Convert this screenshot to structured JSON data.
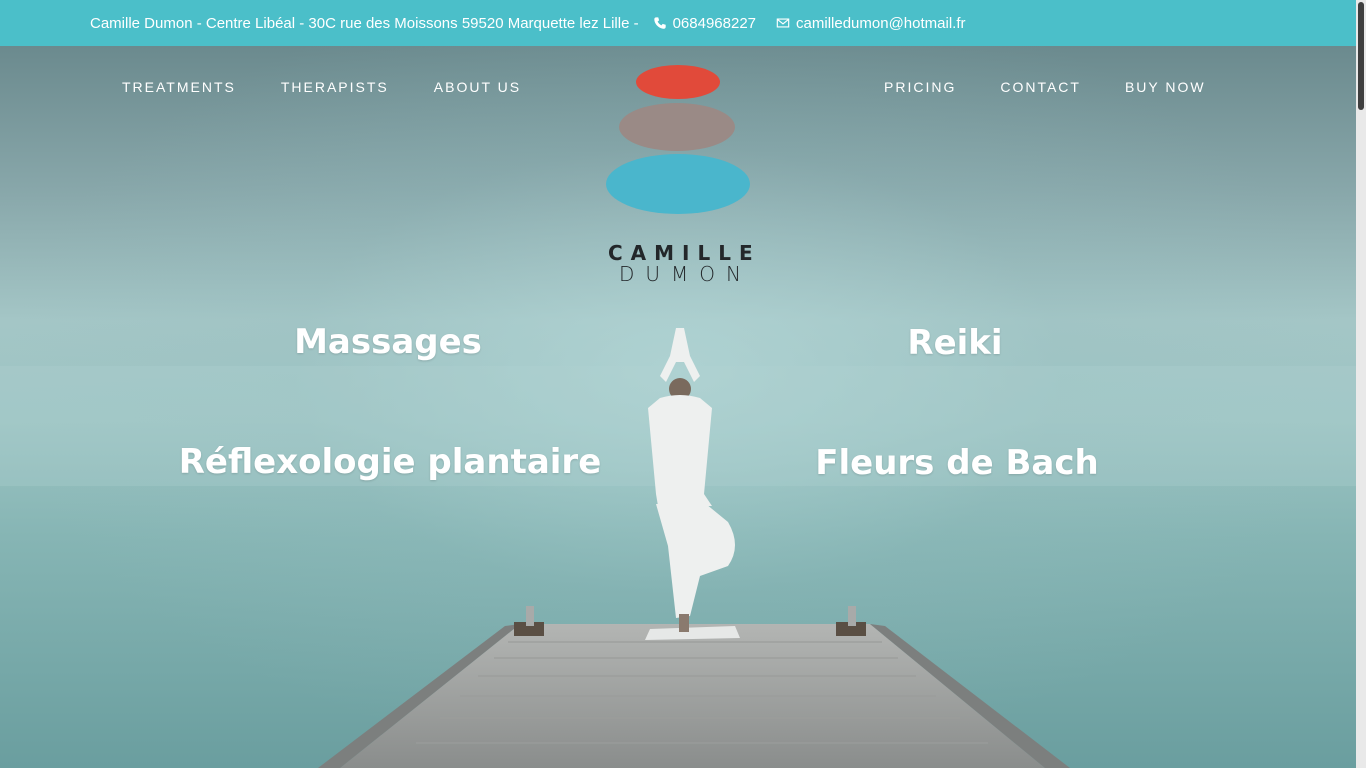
{
  "topbar": {
    "address": "Camille Dumon - Centre Libéal - 30C rue des Moissons 59520 Marquette lez Lille -",
    "phone": "0684968227",
    "email": "camilledumon@hotmail.fr",
    "phone_icon": "phone-icon",
    "email_icon": "envelope-icon"
  },
  "nav": {
    "left": [
      "TREATMENTS",
      "THERAPISTS",
      "ABOUT US"
    ],
    "right": [
      "PRICING",
      "CONTACT",
      "BUY NOW"
    ]
  },
  "logo": {
    "line1": "CAMILLE",
    "line2": "DUMON"
  },
  "services": {
    "massages": "Massages",
    "reiki": "Reiki",
    "reflexologie": "Réflexologie plantaire",
    "bach": "Fleurs de Bach"
  },
  "colors": {
    "topbar": "#4bbfc9",
    "stone_top": "#e14a3a",
    "stone_mid": "#9a8a86",
    "stone_bottom": "#4ab6cc"
  }
}
